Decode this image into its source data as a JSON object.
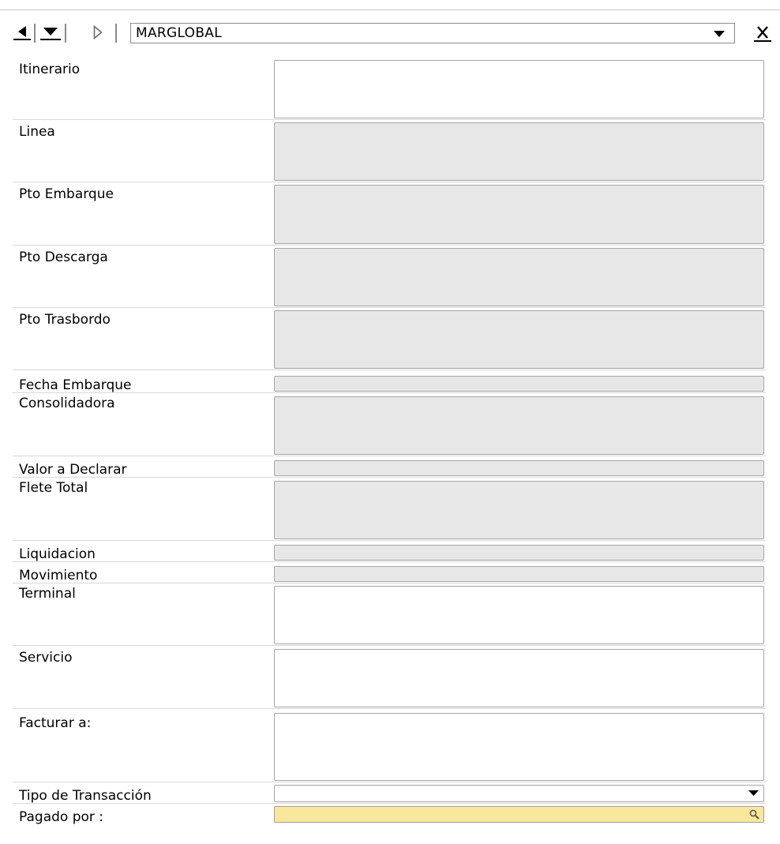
{
  "toolbar": {
    "combo_value": "MARGLOBAL"
  },
  "fields": [
    {
      "label": "Itinerario",
      "value": "",
      "state": "editable"
    },
    {
      "label": "Linea",
      "value": "",
      "state": "readonly"
    },
    {
      "label": "Pto Embarque",
      "value": "",
      "state": "readonly"
    },
    {
      "label": "Pto Descarga",
      "value": "",
      "state": "readonly"
    },
    {
      "label": "Pto Trasbordo",
      "value": "",
      "state": "readonly"
    },
    {
      "label": "Fecha Embarque",
      "value": "",
      "state": "readonly"
    },
    {
      "label": "Consolidadora",
      "value": "",
      "state": "readonly"
    },
    {
      "label": "Valor a Declarar",
      "value": "",
      "state": "readonly"
    },
    {
      "label": "Flete Total",
      "value": "",
      "state": "readonly"
    },
    {
      "label": "Liquidacion",
      "value": "",
      "state": "readonly"
    },
    {
      "label": "Movimiento",
      "value": "",
      "state": "readonly"
    },
    {
      "label": "Terminal",
      "value": "",
      "state": "editable"
    },
    {
      "label": "Servicio",
      "value": "",
      "state": "editable"
    },
    {
      "label": "Facturar a:",
      "value": "",
      "state": "editable"
    },
    {
      "label": "Tipo de Transacción",
      "value": "",
      "state": "dropdown"
    },
    {
      "label": "Pagado por :",
      "value": "",
      "state": "lookup"
    }
  ],
  "colors": {
    "readonly_bg": "#e7e7e7",
    "lookup_bg": "#fbe79c",
    "field_border": "#a6a6a6"
  },
  "icons": {
    "prev": "triangle-left-icon",
    "next_dropdown": "triangle-down-icon",
    "next": "triangle-right-outline-icon",
    "combo_arrow": "chevron-down-icon",
    "close": "close-x-icon",
    "lookup": "search-icon"
  }
}
